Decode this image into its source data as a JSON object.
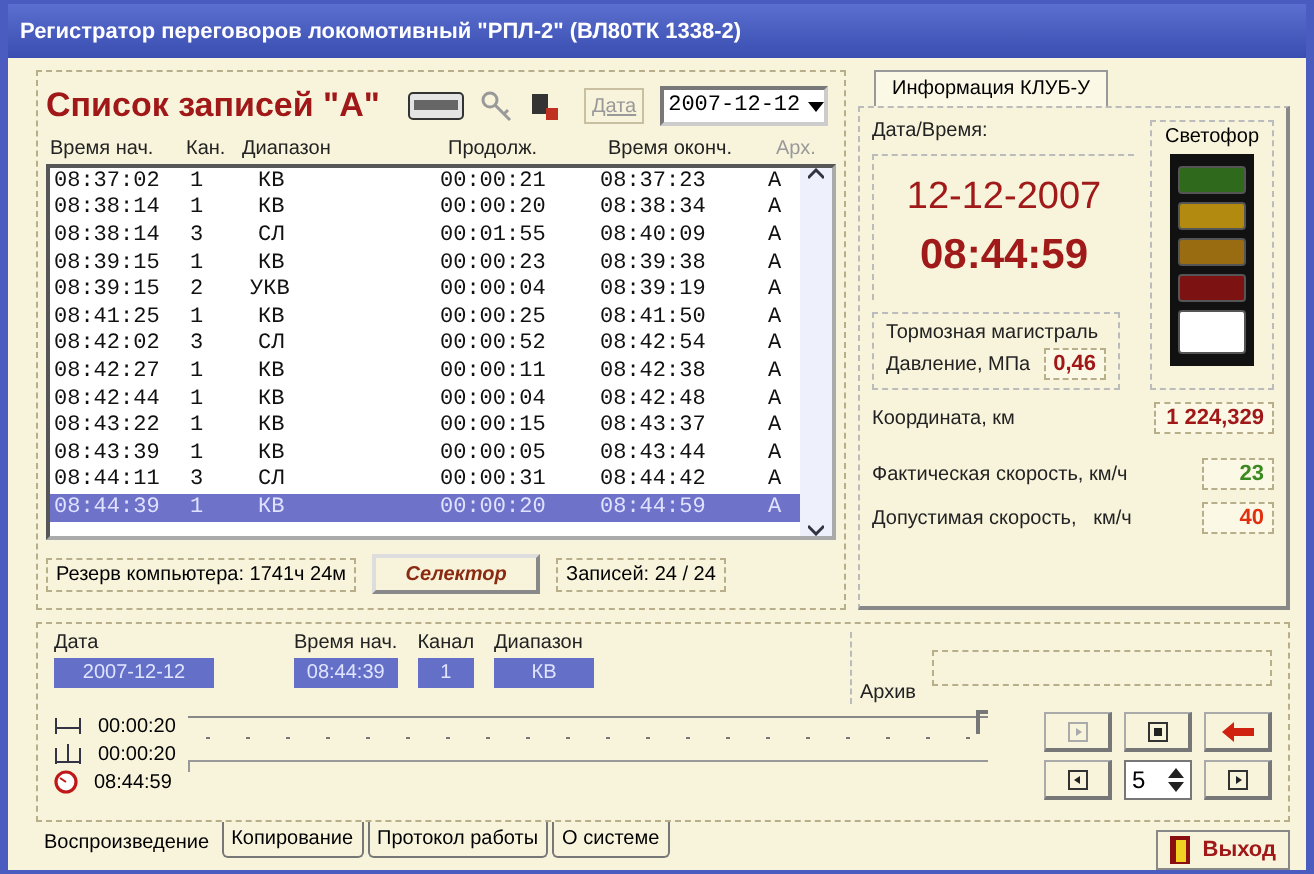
{
  "window": {
    "title": "Регистратор переговоров локомотивный \"РПЛ-2\" (ВЛ80ТК 1338-2)"
  },
  "records": {
    "title": "Список записей \"А\"",
    "date_label": "Дата",
    "date": "2007-12-12",
    "columns": [
      "Время нач.",
      "Кан.",
      "Диапазон",
      "Продолж.",
      "Время оконч.",
      "Арх."
    ],
    "rows": [
      {
        "cells": [
          "08:37:02",
          "1",
          "КВ",
          "00:00:21",
          "08:37:23",
          "А"
        ],
        "selected": false
      },
      {
        "cells": [
          "08:38:14",
          "1",
          "КВ",
          "00:00:20",
          "08:38:34",
          "А"
        ],
        "selected": false
      },
      {
        "cells": [
          "08:38:14",
          "3",
          "СЛ",
          "00:01:55",
          "08:40:09",
          "А"
        ],
        "selected": false
      },
      {
        "cells": [
          "08:39:15",
          "1",
          "КВ",
          "00:00:23",
          "08:39:38",
          "А"
        ],
        "selected": false
      },
      {
        "cells": [
          "08:39:15",
          "2",
          "УКВ",
          "00:00:04",
          "08:39:19",
          "А"
        ],
        "selected": false
      },
      {
        "cells": [
          "08:41:25",
          "1",
          "КВ",
          "00:00:25",
          "08:41:50",
          "А"
        ],
        "selected": false
      },
      {
        "cells": [
          "08:42:02",
          "3",
          "СЛ",
          "00:00:52",
          "08:42:54",
          "А"
        ],
        "selected": false
      },
      {
        "cells": [
          "08:42:27",
          "1",
          "КВ",
          "00:00:11",
          "08:42:38",
          "А"
        ],
        "selected": false
      },
      {
        "cells": [
          "08:42:44",
          "1",
          "КВ",
          "00:00:04",
          "08:42:48",
          "А"
        ],
        "selected": false
      },
      {
        "cells": [
          "08:43:22",
          "1",
          "КВ",
          "00:00:15",
          "08:43:37",
          "А"
        ],
        "selected": false
      },
      {
        "cells": [
          "08:43:39",
          "1",
          "КВ",
          "00:00:05",
          "08:43:44",
          "А"
        ],
        "selected": false
      },
      {
        "cells": [
          "08:44:11",
          "3",
          "СЛ",
          "00:00:31",
          "08:44:42",
          "А"
        ],
        "selected": false
      },
      {
        "cells": [
          "08:44:39",
          "1",
          "КВ",
          "00:00:20",
          "08:44:59",
          "А"
        ],
        "selected": true
      }
    ],
    "reserve": "Резерв компьютера: 1741ч 24м",
    "selector_button": "Селектор",
    "count": "Записей: 24 / 24"
  },
  "info": {
    "tab": "Информация КЛУБ-У",
    "datetime_label": "Дата/Время:",
    "date": "12-12-2007",
    "time": "08:44:59",
    "signal_label": "Светофор",
    "lights": [
      {
        "color": "#2f6a1c"
      },
      {
        "color": "#b38a10"
      },
      {
        "color": "#9a6c12"
      },
      {
        "color": "#7c1212"
      },
      {
        "color": "#ffffff"
      }
    ],
    "brake_title": "Тормозная магистраль",
    "pressure_label": "Давление, МПа",
    "pressure": "0,46",
    "coordinate_label": "Координата, км",
    "coordinate": "1 224,329",
    "actual_speed_label": "Фактическая скорость, км/ч",
    "actual_speed": "23",
    "allowed_speed_label": "Допустимая скорость,   км/ч",
    "allowed_speed": "40"
  },
  "playback": {
    "fields": [
      {
        "label": "Дата",
        "value": "2007-12-12"
      },
      {
        "label": "Время нач.",
        "value": "08:44:39"
      },
      {
        "label": "Канал",
        "value": "1"
      },
      {
        "label": "Диапазон",
        "value": "КВ"
      }
    ],
    "archive_label": "Архив",
    "times": [
      {
        "kind": "length",
        "value": "00:00:20"
      },
      {
        "kind": "position",
        "value": "00:00:20"
      },
      {
        "kind": "clock",
        "value": "08:44:59"
      }
    ],
    "level": 1,
    "step": "5"
  },
  "tabs": [
    {
      "label": "Воспроизведение",
      "selected": true
    },
    {
      "label": "Копирование",
      "selected": false
    },
    {
      "label": "Протокол работы",
      "selected": false
    },
    {
      "label": "О системе",
      "selected": false
    }
  ],
  "exit_button": "Выход"
}
